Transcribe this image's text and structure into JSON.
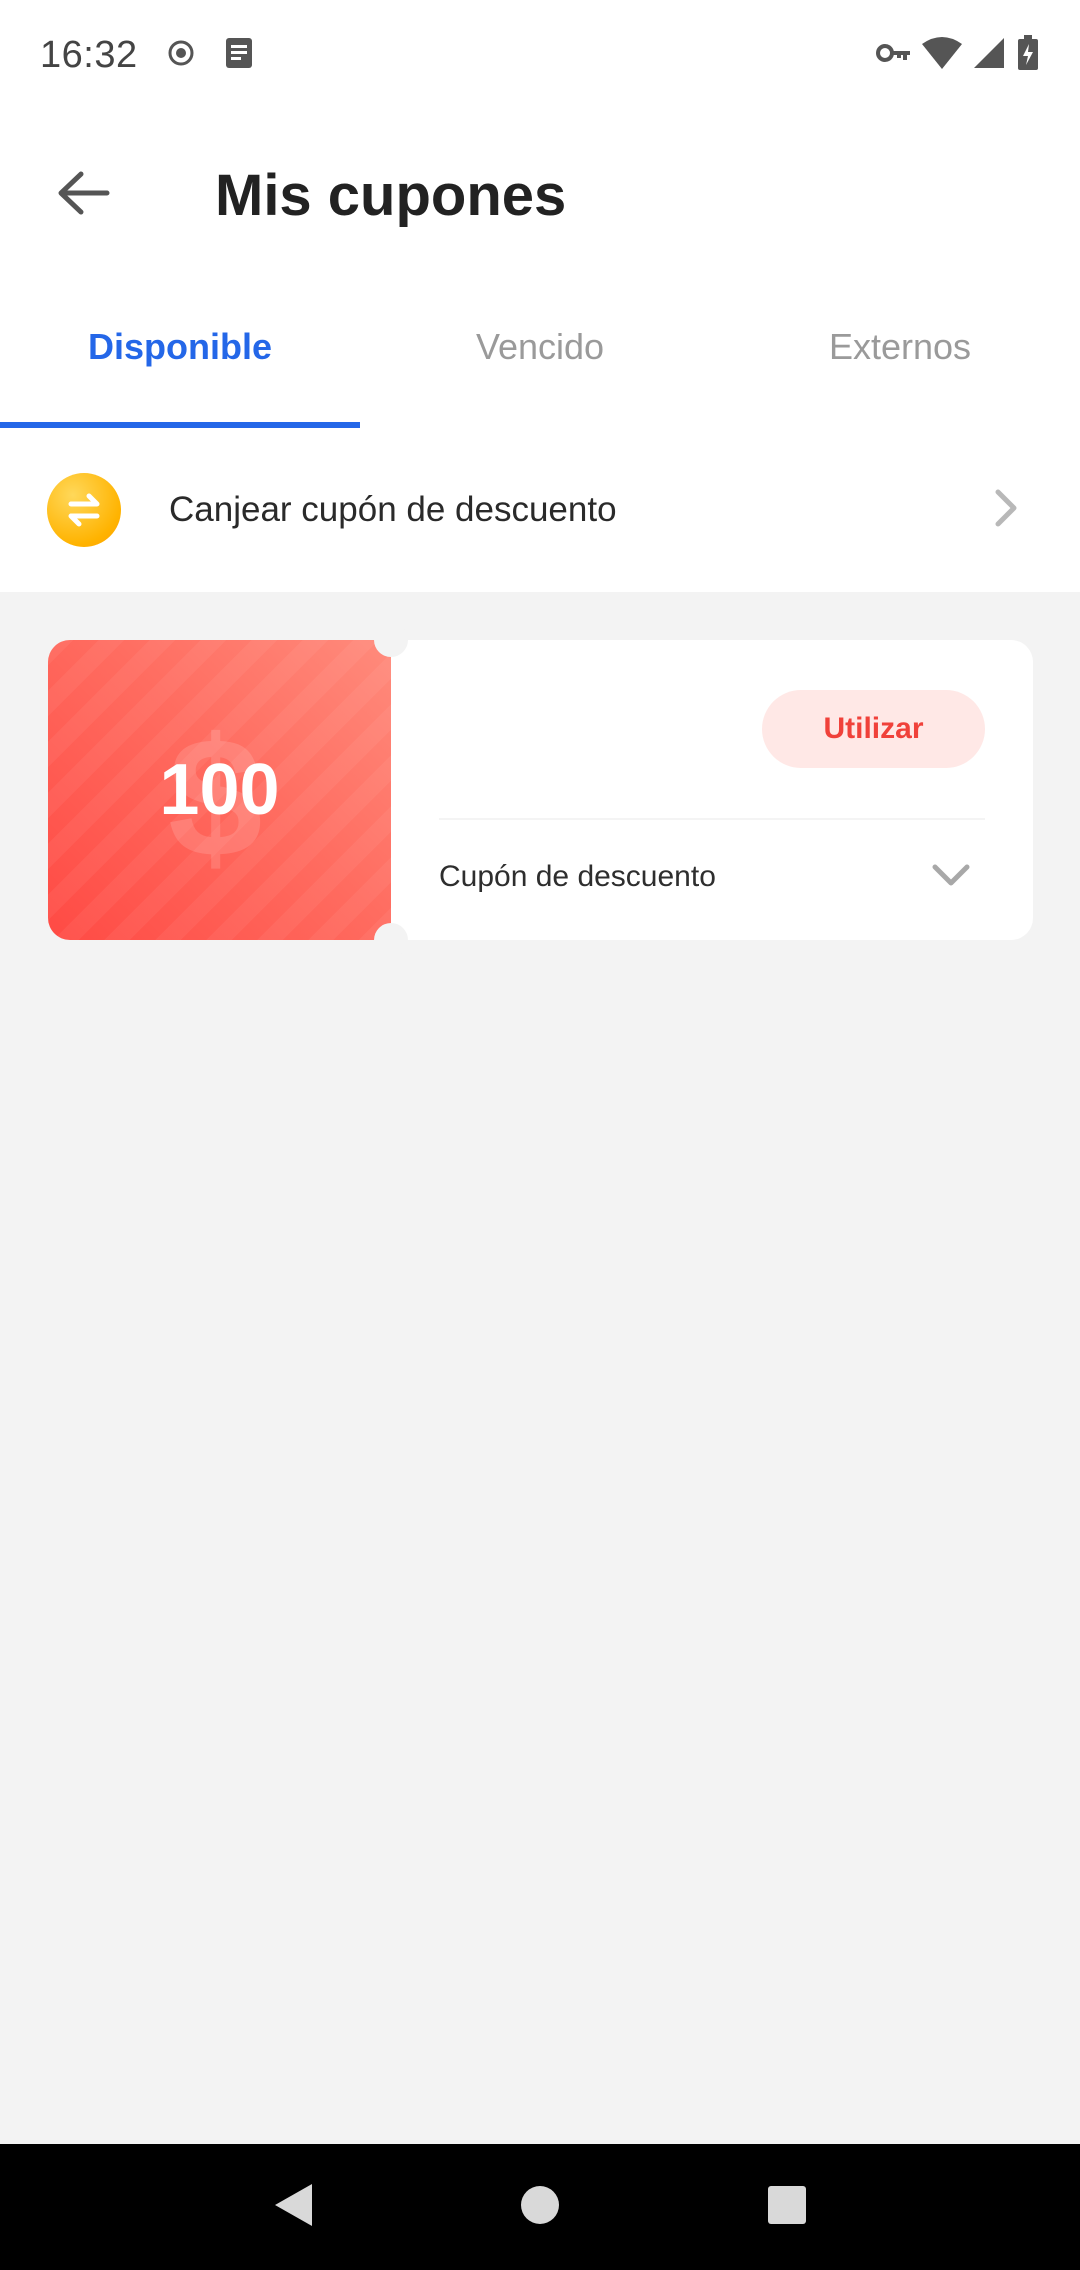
{
  "status_bar": {
    "time": "16:32",
    "icons": [
      "record-icon",
      "notes-icon",
      "vpn-key-icon",
      "wifi-icon",
      "signal-icon",
      "battery-icon"
    ]
  },
  "header": {
    "back_icon": "arrow-left-icon",
    "title": "Mis cupones"
  },
  "tabs": [
    {
      "label": "Disponible",
      "active": true
    },
    {
      "label": "Vencido",
      "active": false
    },
    {
      "label": "Externos",
      "active": false
    }
  ],
  "redeem": {
    "icon": "exchange-coin-icon",
    "label": "Canjear cupón de descuento",
    "chevron": "chevron-right-icon"
  },
  "coupons": [
    {
      "amount": "100",
      "action_label": "Utilizar",
      "type_label": "Cupón de descuento",
      "expand_icon": "chevron-down-icon"
    }
  ],
  "colors": {
    "accent": "#2467e8",
    "coupon_red": "#ff4a44",
    "coupon_button_bg": "#ffe8e6",
    "coupon_button_text": "#f0413a",
    "redeem_icon": "#ffb300"
  },
  "nav_bar": {
    "buttons": [
      "back-triangle-icon",
      "home-circle-icon",
      "recents-square-icon"
    ]
  }
}
